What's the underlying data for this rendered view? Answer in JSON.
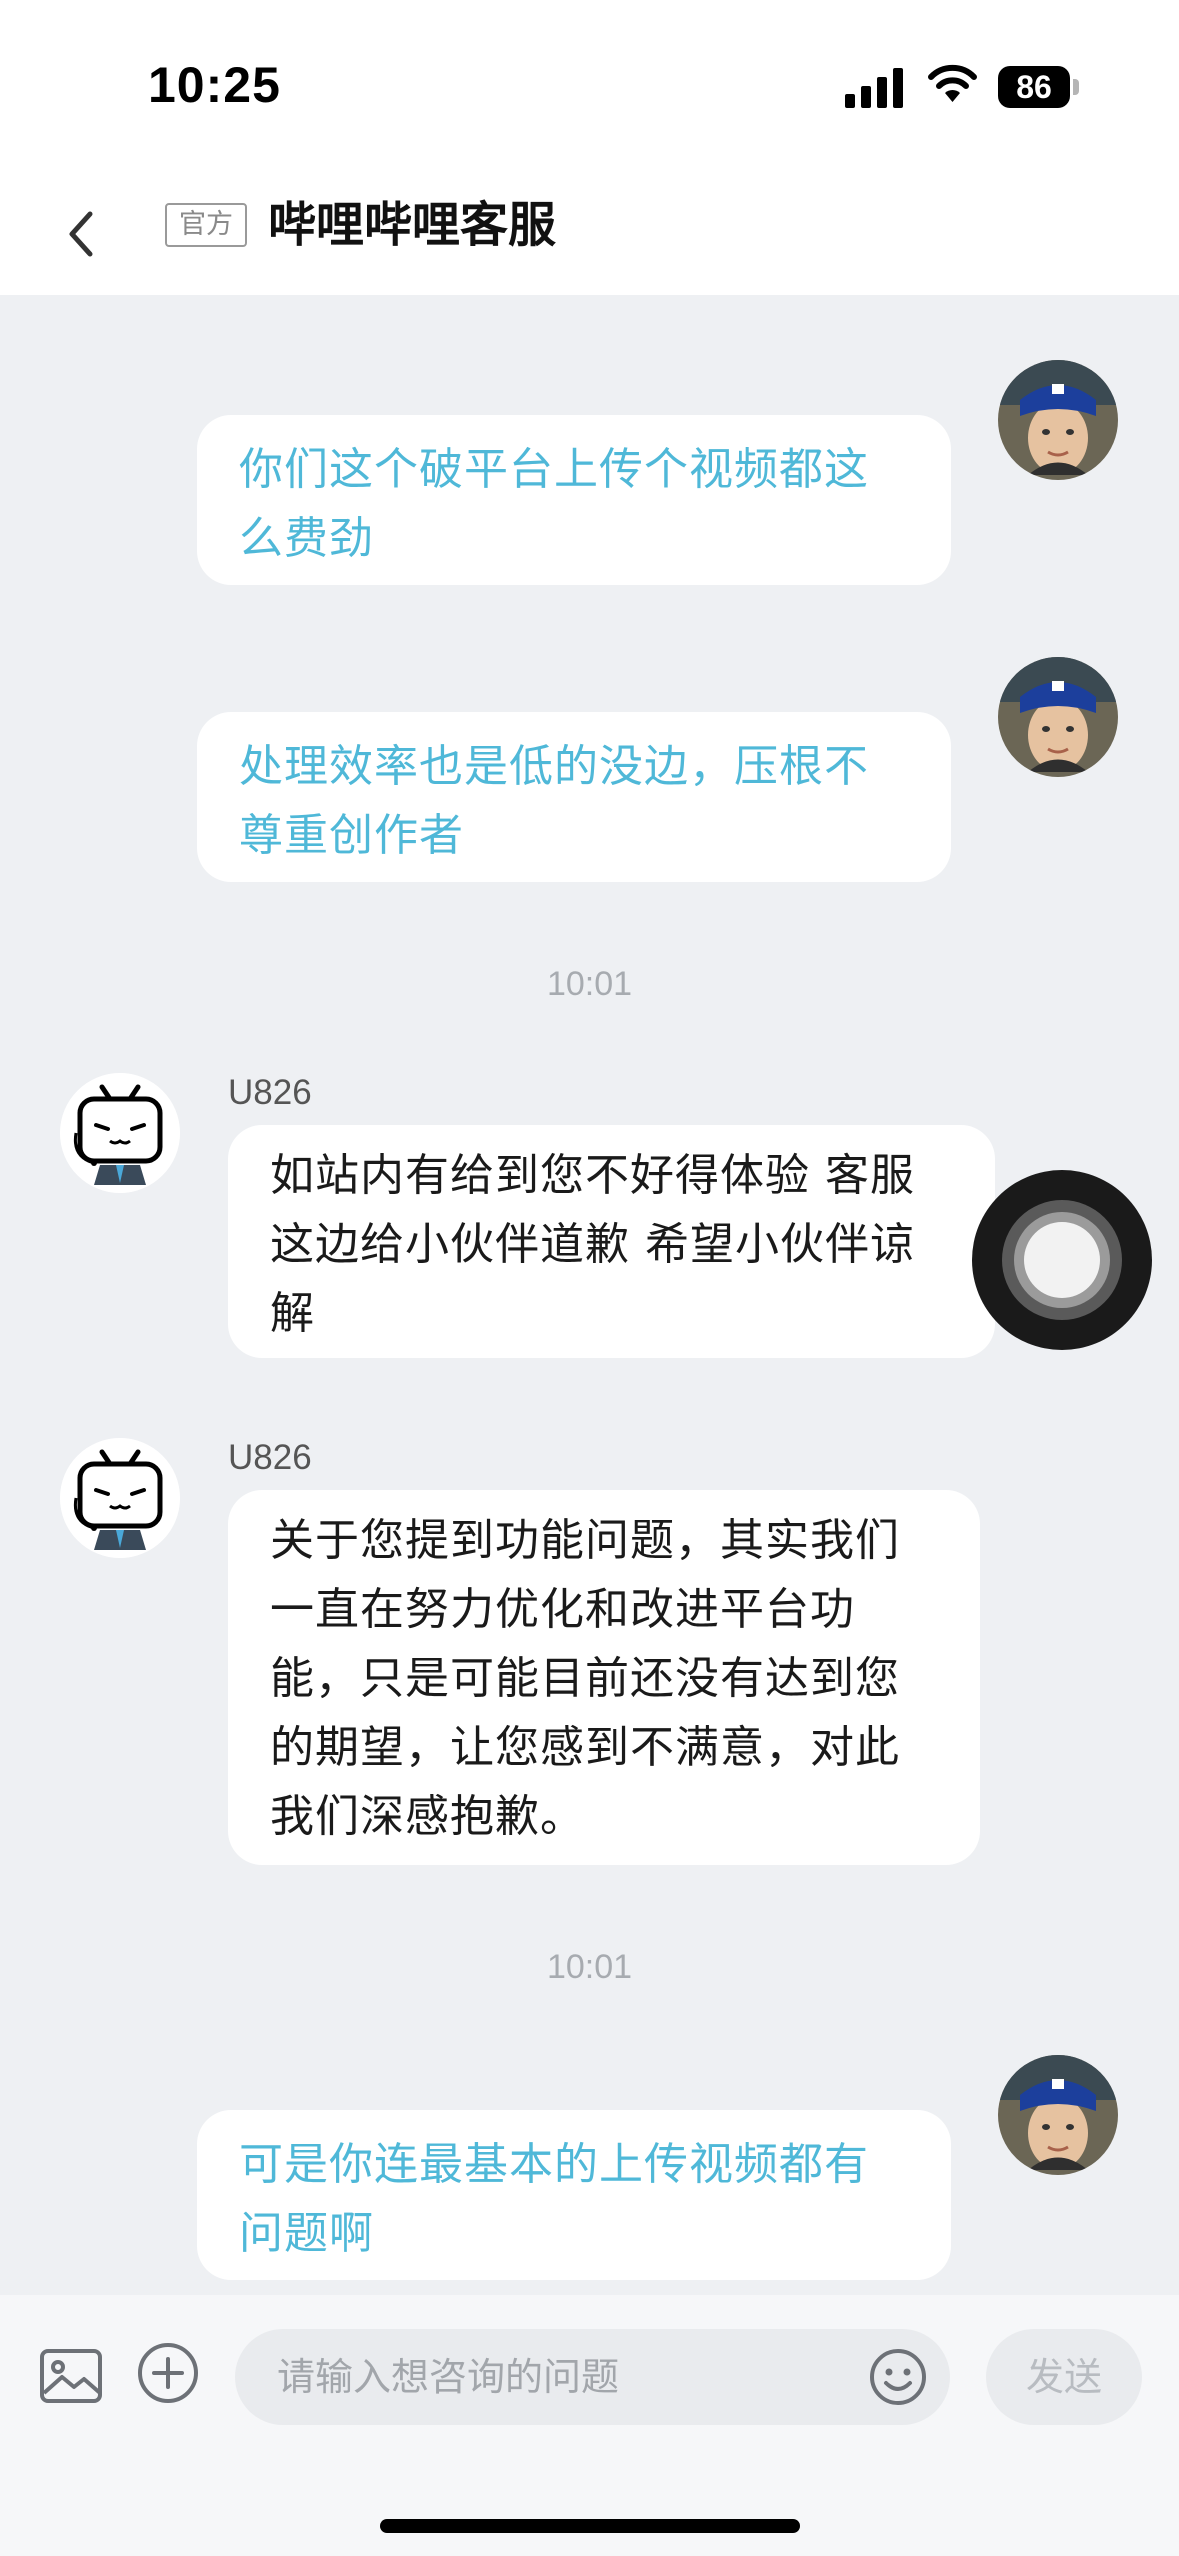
{
  "status_bar": {
    "time": "10:25",
    "battery": "86",
    "icons": [
      "signal-icon",
      "wifi-icon",
      "battery-icon"
    ]
  },
  "nav": {
    "back_icon": "chevron-left-icon",
    "badge": "官方",
    "title": "哔哩哔哩客服"
  },
  "messages": [
    {
      "side": "mine",
      "text_lines": [
        "你们这个破平台上传个视频都这",
        "么费劲"
      ]
    },
    {
      "side": "mine",
      "text_lines": [
        "处理效率也是低的没边，压根不",
        "尊重创作者"
      ]
    },
    {
      "timestamp": "10:01"
    },
    {
      "side": "theirs",
      "sender": "U826",
      "text_lines": [
        "如站内有给到您不好得体验 客服",
        "这边给小伙伴道歉 希望小伙伴谅",
        "解"
      ]
    },
    {
      "side": "theirs",
      "sender": "U826",
      "text_lines": [
        "关于您提到功能问题，其实我们",
        "一直在努力优化和改进平台功",
        "能，只是可能目前还没有达到您",
        "的期望，让您感到不满意，对此",
        "我们深感抱歉。"
      ]
    },
    {
      "timestamp": "10:01"
    },
    {
      "side": "mine",
      "text_lines": [
        "可是你连最基本的上传视频都有",
        "问题啊"
      ]
    }
  ],
  "input_bar": {
    "placeholder": "请输入想咨询的问题",
    "send_label": "发送",
    "icons": [
      "image-icon",
      "plus-icon",
      "emoji-icon"
    ]
  },
  "colors": {
    "my_text": "#4fb8d8",
    "background": "#eef0f3",
    "bubble": "#ffffff"
  }
}
